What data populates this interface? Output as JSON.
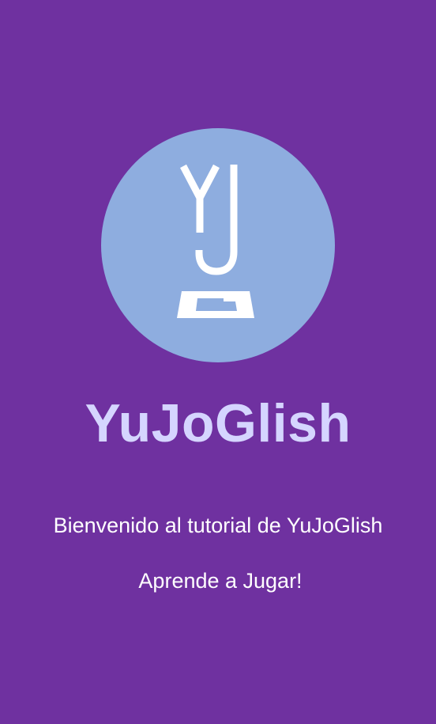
{
  "colors": {
    "background": "#6f31a0",
    "logo_circle": "#8eaddf",
    "app_name": "#d5d5ff",
    "text": "#ffffff"
  },
  "logo": {
    "icon": "yj-podium-logo-icon"
  },
  "app_name": "YuJoGlish",
  "welcome": "Bienvenido al tutorial de YuJoGlish",
  "call_to_action": "Aprende a Jugar!"
}
